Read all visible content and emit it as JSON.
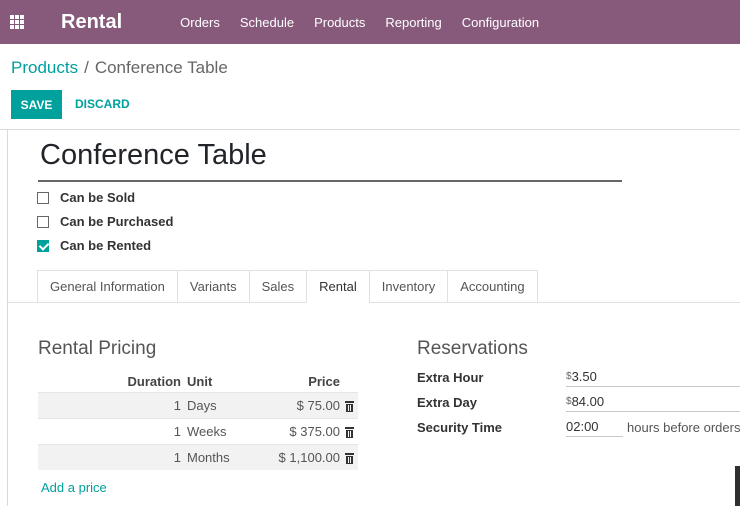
{
  "topbar": {
    "app_name": "Rental",
    "menu": [
      "Orders",
      "Schedule",
      "Products",
      "Reporting",
      "Configuration"
    ]
  },
  "breadcrumb": {
    "parent": "Products",
    "separator": "/",
    "current": "Conference Table"
  },
  "actions": {
    "save": "SAVE",
    "discard": "DISCARD"
  },
  "product": {
    "name": "Conference Table",
    "options": [
      {
        "label": "Can be Sold",
        "checked": false
      },
      {
        "label": "Can be Purchased",
        "checked": false
      },
      {
        "label": "Can be Rented",
        "checked": true
      }
    ]
  },
  "tabs": [
    "General Information",
    "Variants",
    "Sales",
    "Rental",
    "Inventory",
    "Accounting"
  ],
  "active_tab": "Rental",
  "rental_pricing": {
    "title": "Rental Pricing",
    "columns": {
      "duration": "Duration",
      "unit": "Unit",
      "price": "Price"
    },
    "rows": [
      {
        "duration": "1",
        "unit": "Days",
        "price": "$ 75.00"
      },
      {
        "duration": "1",
        "unit": "Weeks",
        "price": "$ 375.00"
      },
      {
        "duration": "1",
        "unit": "Months",
        "price": "$ 1,100.00"
      }
    ],
    "add_label": "Add a price"
  },
  "reservations": {
    "title": "Reservations",
    "extra_hour": {
      "label": "Extra Hour",
      "currency": "$",
      "value": "3.50"
    },
    "extra_day": {
      "label": "Extra Day",
      "currency": "$",
      "value": "84.00"
    },
    "security_time": {
      "label": "Security Time",
      "value": "02:00",
      "suffix": "hours before orders"
    }
  },
  "colors": {
    "brand": "#875a7b",
    "accent": "#00a09d"
  }
}
